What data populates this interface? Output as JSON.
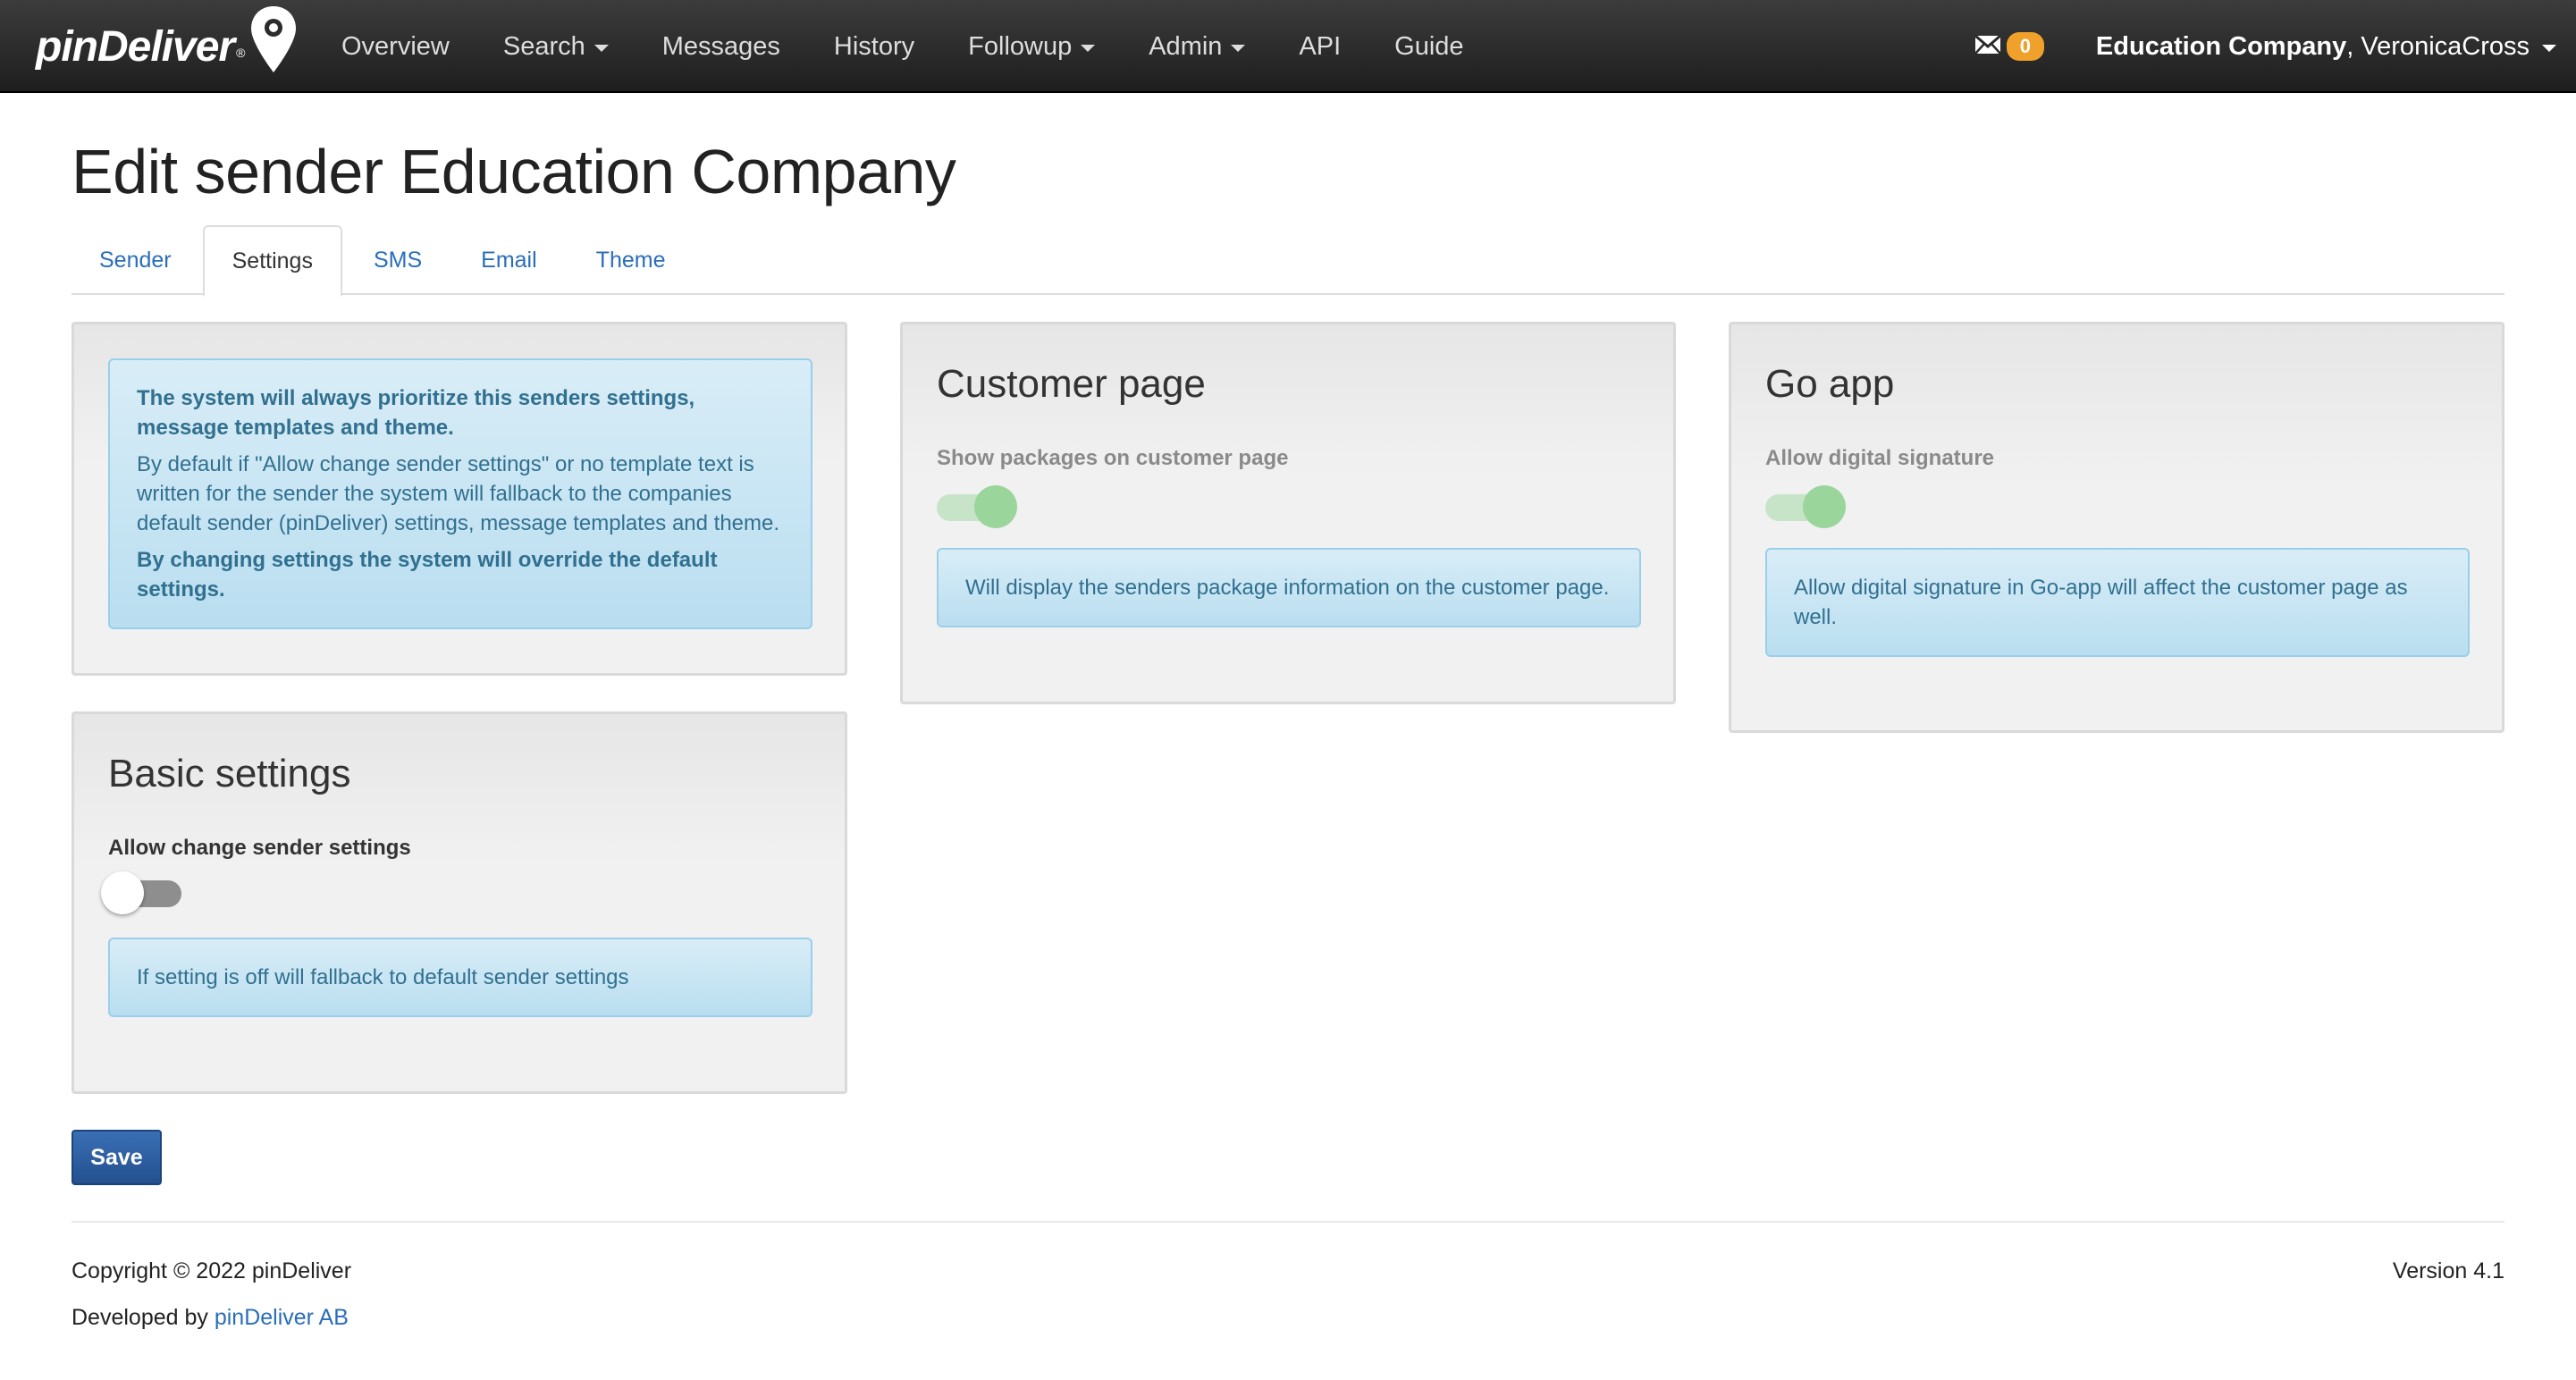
{
  "brand": {
    "name": "pinDeliver",
    "trademark": "®"
  },
  "nav": {
    "items": [
      {
        "label": "Overview",
        "dropdown": false
      },
      {
        "label": "Search",
        "dropdown": true
      },
      {
        "label": "Messages",
        "dropdown": false
      },
      {
        "label": "History",
        "dropdown": false
      },
      {
        "label": "Followup",
        "dropdown": true
      },
      {
        "label": "Admin",
        "dropdown": true
      },
      {
        "label": "API",
        "dropdown": false
      },
      {
        "label": "Guide",
        "dropdown": false
      }
    ],
    "messages_count": "0",
    "company": "Education Company",
    "separator": ", ",
    "user": "VeronicaCross"
  },
  "page": {
    "title": "Edit sender Education Company"
  },
  "tabs": [
    {
      "label": "Sender",
      "active": false
    },
    {
      "label": "Settings",
      "active": true
    },
    {
      "label": "SMS",
      "active": false
    },
    {
      "label": "Email",
      "active": false
    },
    {
      "label": "Theme",
      "active": false
    }
  ],
  "info_panel": {
    "line1": "The system will always prioritize this senders settings, message templates and theme.",
    "line2": "By default if \"Allow change sender settings\" or no template text is written for the sender the system will fallback to the companies default sender (pinDeliver) settings, message templates and theme.",
    "line3": "By changing settings the system will override the default settings."
  },
  "customer_page": {
    "title": "Customer page",
    "setting_label": "Show packages on customer page",
    "setting_on": true,
    "note": "Will display the senders package information on the customer page."
  },
  "go_app": {
    "title": "Go app",
    "setting_label": "Allow digital signature",
    "setting_on": true,
    "note": "Allow digital signature in Go-app will affect the customer page as well."
  },
  "basic_settings": {
    "title": "Basic settings",
    "setting_label": "Allow change sender settings",
    "setting_on": false,
    "note": "If setting is off will fallback to default sender settings"
  },
  "actions": {
    "save_label": "Save"
  },
  "footer": {
    "copyright": "Copyright © 2022 pinDeliver",
    "developed_prefix": "Developed by ",
    "developed_link": "pinDeliver AB",
    "version": "Version 4.1"
  },
  "colors": {
    "navbar": "#2b2b2b",
    "link": "#2a6ebb",
    "badge": "#f0a12c",
    "alert_bg": "#d9edf7",
    "alert_text": "#31708f",
    "switch_on": "#9ad69b",
    "save_button": "#2d5d9f"
  }
}
